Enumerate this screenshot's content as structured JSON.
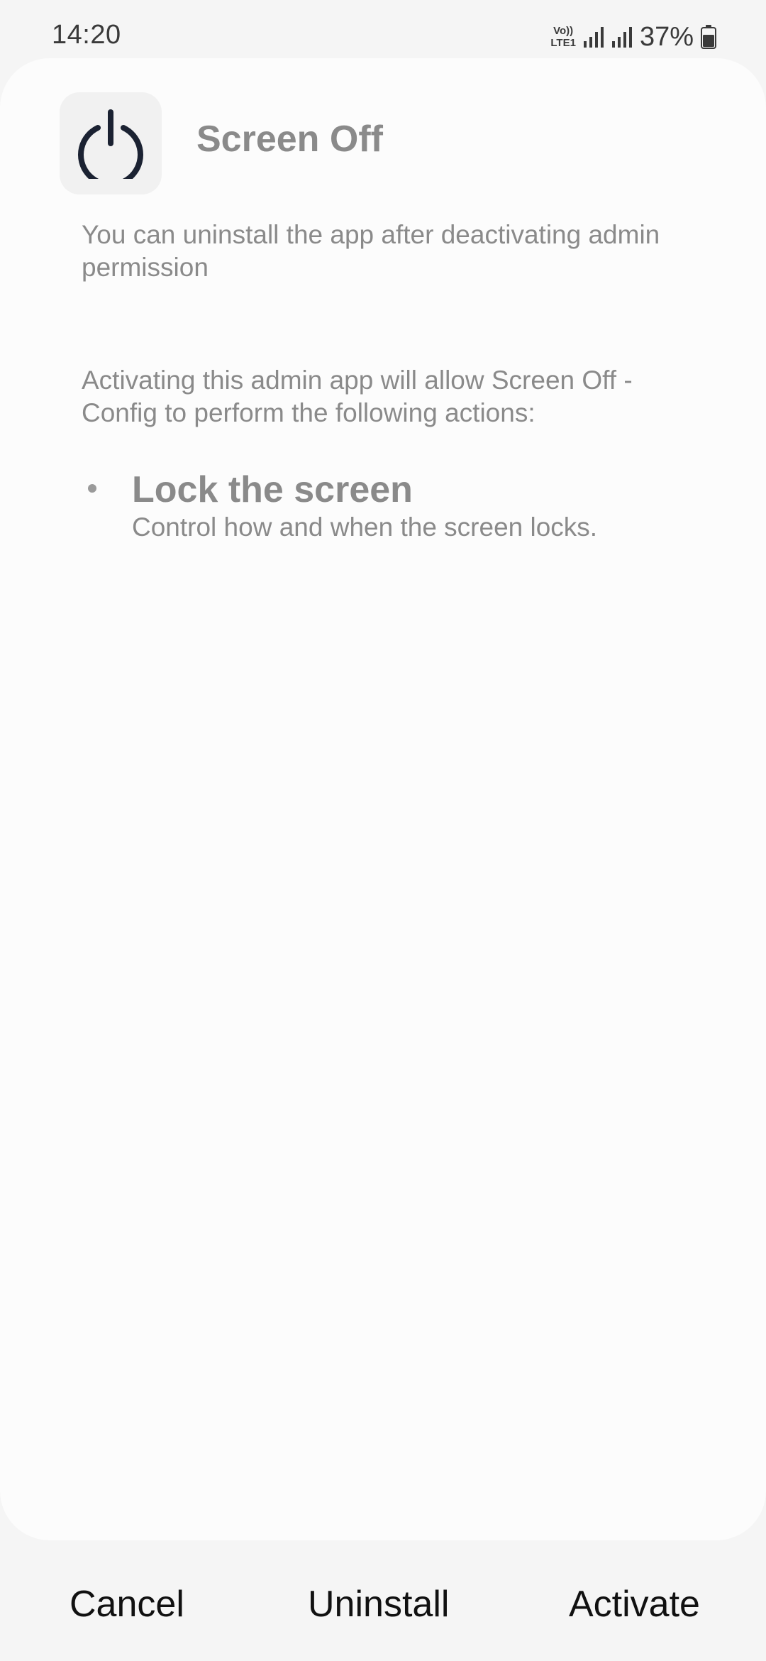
{
  "status_bar": {
    "time": "14:20",
    "volte_top": "Vo))",
    "volte_bottom": "LTE1",
    "battery_percent": "37%",
    "icons": [
      "volte-icon",
      "signal-icon",
      "signal-icon",
      "battery-icon"
    ]
  },
  "app": {
    "icon": "power-icon",
    "name": "Screen Off"
  },
  "content": {
    "uninstall_note": "You can uninstall the app after deactivating admin permission",
    "activation_intro": "Activating this admin app will allow Screen Off - Config to perform the following actions:",
    "permissions": [
      {
        "title": "Lock the screen",
        "description": "Control how and when the screen locks."
      }
    ]
  },
  "buttons": {
    "cancel": "Cancel",
    "uninstall": "Uninstall",
    "activate": "Activate"
  },
  "colors": {
    "background": "#f5f5f5",
    "card": "#fcfcfc",
    "muted_text": "#8a8a8a",
    "button_text": "#111111",
    "power_icon": "#1b2232"
  }
}
